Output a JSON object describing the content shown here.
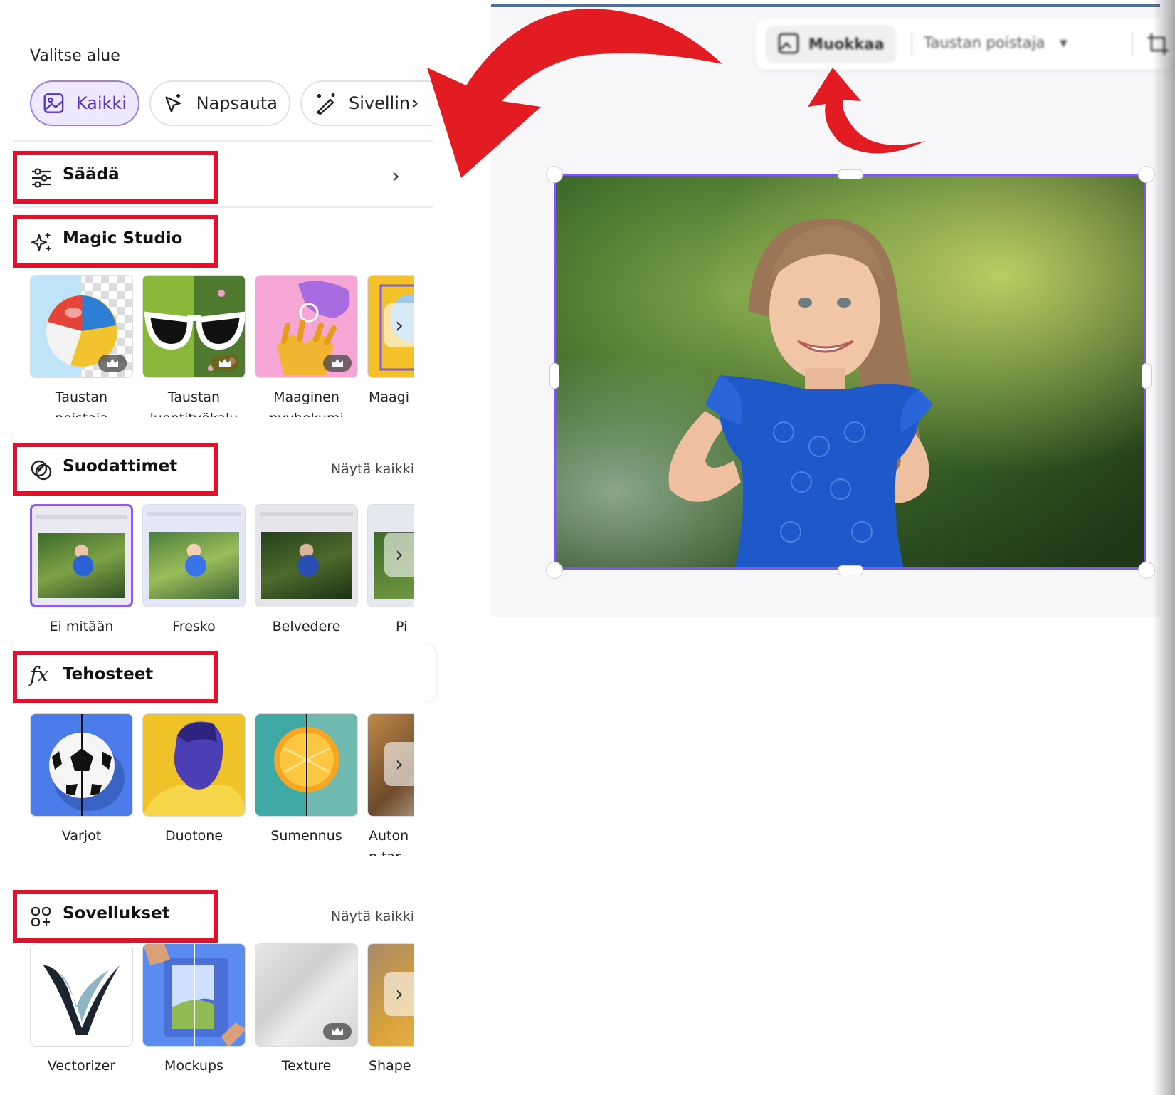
{
  "panel": {
    "select_title": "Valitse alue",
    "pills": [
      {
        "label": "Kaikki",
        "icon": "image-icon",
        "active": true
      },
      {
        "label": "Napsauta",
        "icon": "sparkle-cursor-icon"
      },
      {
        "label": "Sivellin",
        "icon": "magic-brush-icon"
      }
    ],
    "adjust": {
      "title": "Säädä",
      "icon": "sliders-icon",
      "chevron": "›"
    },
    "magic_studio": {
      "title": "Magic Studio",
      "icon": "sparkles-icon",
      "tools": [
        {
          "label": "Taustan\npoistaja",
          "premium": true
        },
        {
          "label": "Taustan\nluontityökalu",
          "premium": true
        },
        {
          "label": "Maaginen\npyyhekumi",
          "premium": true
        },
        {
          "label": "Maagi",
          "premium": false
        }
      ]
    },
    "filters": {
      "title": "Suodattimet",
      "icon": "filter-circles-icon",
      "see_all": "Näytä kaikki",
      "items": [
        {
          "label": "Ei mitään",
          "selected": true
        },
        {
          "label": "Fresko"
        },
        {
          "label": "Belvedere"
        },
        {
          "label": "Pi"
        }
      ]
    },
    "effects": {
      "title": "Tehosteet",
      "icon": "fx-icon",
      "items": [
        {
          "label": "Varjot"
        },
        {
          "label": "Duotone"
        },
        {
          "label": "Sumennus"
        },
        {
          "label": "Auton\nn tar"
        }
      ]
    },
    "apps": {
      "title": "Sovellukset",
      "icon": "apps-grid-icon",
      "see_all": "Näytä kaikki",
      "items": [
        {
          "label": "Vectorizer"
        },
        {
          "label": "Mockups"
        },
        {
          "label": "Texture",
          "premium": true
        },
        {
          "label": "Shape"
        }
      ]
    }
  },
  "toolbar": {
    "edit_label": "Muokkaa",
    "bg_remover_label": "Taustan poistaja",
    "dropdown_caret": "▾"
  },
  "colors": {
    "highlight_red": "#e0112b",
    "accent_purple": "#8a5cf0",
    "arrow_red": "#e31b23"
  }
}
